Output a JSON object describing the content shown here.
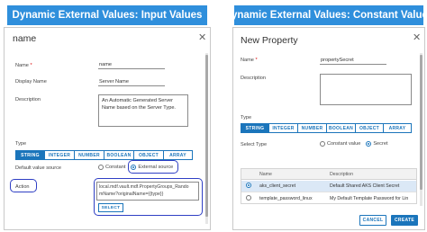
{
  "left_banner": "Dynamic External Values: Input Values",
  "right_banner": "Dynamic External Values: Constant Values",
  "left_panel": {
    "title": "name",
    "name_label": "Name",
    "required_mark": "*",
    "name_value": "name",
    "display_name_label": "Display Name",
    "display_name_value": "Server Name",
    "description_label": "Description",
    "description_lines": [
      "An Automatic Generated Server",
      "Name based on the Server Type."
    ],
    "type_label": "Type",
    "type_tabs": [
      "STRING",
      "INTEGER",
      "NUMBER",
      "BOOLEAN",
      "OBJECT",
      "ARRAY"
    ],
    "active_tab": "STRING",
    "default_value_source_label": "Default value source",
    "source_options": [
      "Constant",
      "External source"
    ],
    "selected_source": "External source",
    "action_label": "Action",
    "action_lines": [
      "local.mdf.vault.mdf.PropertyGroups_Rando",
      "mName?originalName={{type}}"
    ],
    "select_button": "SELECT"
  },
  "right_panel": {
    "title": "New Property",
    "name_label": "Name",
    "required_mark": "*",
    "name_value": "propertySecret",
    "description_label": "Description",
    "type_label": "Type",
    "type_tabs": [
      "STRING",
      "INTEGER",
      "NUMBER",
      "BOOLEAN",
      "OBJECT",
      "ARRAY"
    ],
    "active_tab": "STRING",
    "select_type_label": "Select Type",
    "type_options": [
      "Constant value",
      "Secret"
    ],
    "selected_type": "Secret",
    "grid": {
      "columns": [
        "Name",
        "Description"
      ],
      "rows": [
        {
          "name": "aks_client_secret",
          "description": "Default Shared AKS Client Secret",
          "selected": true
        },
        {
          "name": "template_password_linux",
          "description": "My Default Template Password for Lin",
          "selected": false
        }
      ]
    },
    "cancel_button": "CANCEL",
    "create_button": "CREATE"
  },
  "icons": {
    "close": "close-icon",
    "radio": "radio-icon"
  },
  "colors": {
    "banner": "#2f8fdc",
    "accent": "#1b75bb",
    "highlight": "#2f3fc4",
    "required": "#dd1111"
  }
}
